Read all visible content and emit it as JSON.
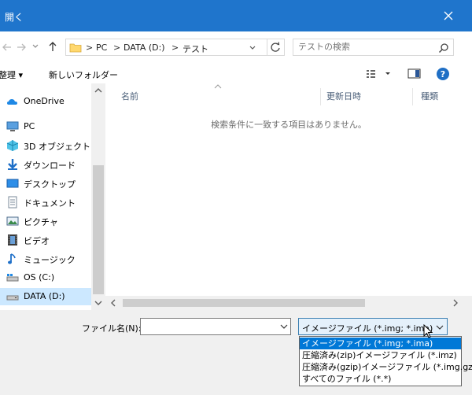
{
  "window": {
    "title": "開く"
  },
  "address": {
    "crumbs": [
      "PC",
      "DATA (D:)",
      "テスト"
    ],
    "separator": ">"
  },
  "search": {
    "placeholder": "テストの検索"
  },
  "toolbar": {
    "organize": "整理 ▾",
    "new_folder": "新しいフォルダー"
  },
  "nav": {
    "items": [
      {
        "label": "OneDrive",
        "icon": "onedrive-icon"
      },
      {
        "label": "PC",
        "icon": "pc-icon"
      },
      {
        "label": "3D オブジェクト",
        "icon": "3d-objects-icon"
      },
      {
        "label": "ダウンロード",
        "icon": "download-icon"
      },
      {
        "label": "デスクトップ",
        "icon": "desktop-icon"
      },
      {
        "label": "ドキュメント",
        "icon": "documents-icon"
      },
      {
        "label": "ピクチャ",
        "icon": "pictures-icon"
      },
      {
        "label": "ビデオ",
        "icon": "videos-icon"
      },
      {
        "label": "ミュージック",
        "icon": "music-icon"
      },
      {
        "label": "OS (C:)",
        "icon": "drive-c-icon"
      },
      {
        "label": "DATA (D:)",
        "icon": "drive-d-icon",
        "selected": true
      }
    ]
  },
  "columns": [
    "名前",
    "更新日時",
    "種類"
  ],
  "empty_message": "検索条件に一致する項目はありません。",
  "filename": {
    "label": "ファイル名(N):",
    "value": ""
  },
  "filetype": {
    "selected": "イメージファイル (*.img; *.ima)",
    "options": [
      "イメージファイル (*.img; *.ima)",
      "圧縮済み(zip)イメージファイル (*.imz)",
      "圧縮済み(gzip)イメージファイル (*.img.gz)",
      "すべてのファイル (*.*)"
    ]
  },
  "colors": {
    "titlebar": "#1f75cc",
    "selection": "#0078d7",
    "nav_selected": "#cce8ff"
  }
}
